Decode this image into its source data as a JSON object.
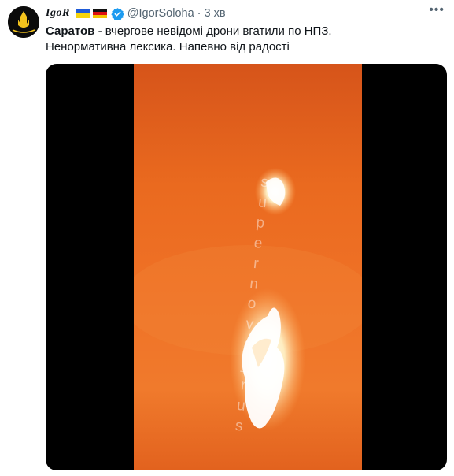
{
  "author": {
    "name": "IgoR",
    "handle": "@IgorSoloha",
    "separator": "·",
    "time": "3 хв",
    "avatar_label": "UKRAINE",
    "flags": [
      "flag-ukraine",
      "flag-germany"
    ]
  },
  "tweet": {
    "bold_lead": "Саратов",
    "line1_rest": " - вчергове невідомі дрони вгатили по НПЗ.",
    "line2": "Ненормативна лексика. Напевно від радості"
  },
  "media": {
    "watermark": "supernova_rus"
  },
  "icons": {
    "more": "more-icon",
    "verified": "verified-badge-icon"
  },
  "colors": {
    "verified": "#1d9bf0",
    "secondary_text": "#536471",
    "video_orange": "#ef7126"
  }
}
